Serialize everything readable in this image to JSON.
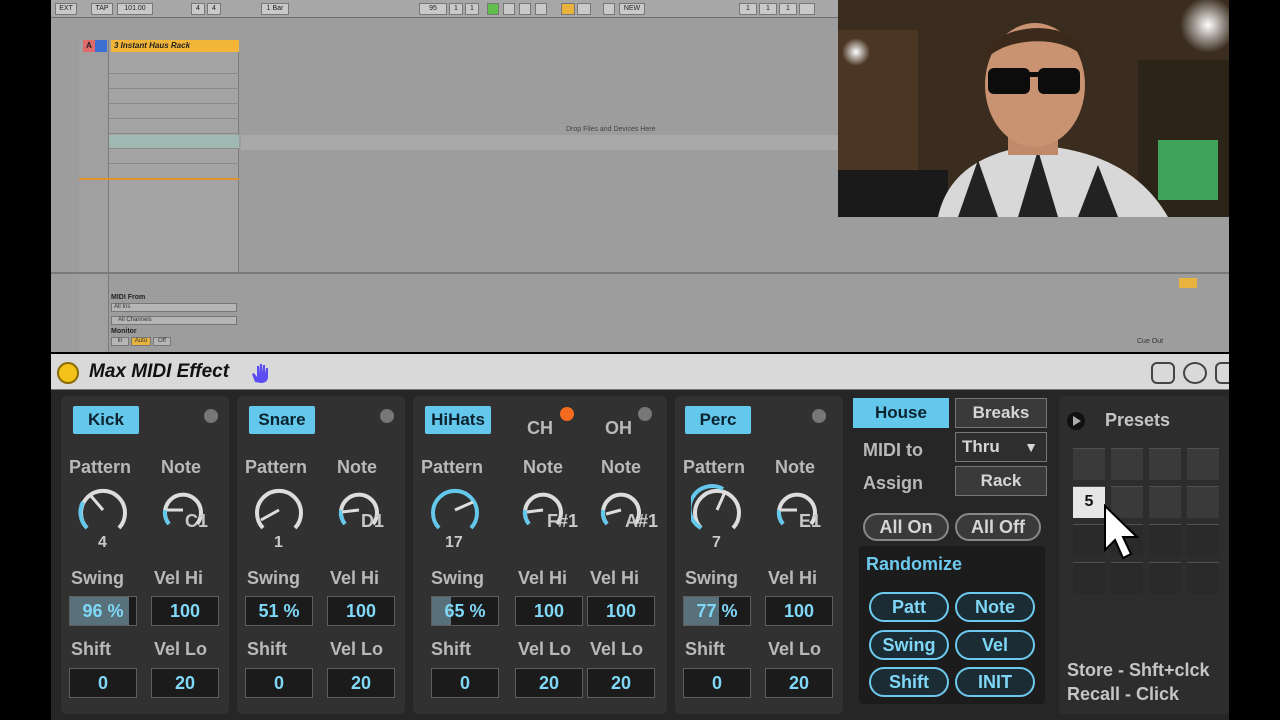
{
  "transport": {
    "ext": "EXT",
    "tap": "TAP",
    "tempo": "101.00",
    "sig_num": "4",
    "sig_den": "4",
    "quant": "1 Bar",
    "bars": "95",
    "beats": "1",
    "six": "1",
    "new": "NEW",
    "pos_a": "1",
    "pos_b": "1",
    "pos_c": "1"
  },
  "session": {
    "track_letter_a": "A",
    "track_name": "3 Instant Haus Rack",
    "drop_hint": "Drop Files and Devices Here",
    "midi_from": "MIDI From",
    "input_type": "All Ins",
    "input_channel": "All Channels",
    "monitor": "Monitor",
    "mon_in": "In",
    "mon_auto": "Auto",
    "mon_off": "Off",
    "cue_out": "Cue Out"
  },
  "device": {
    "title": "Max MIDI Effect",
    "channels": [
      {
        "name": "Kick",
        "pattern_label": "Pattern",
        "note_label": "Note",
        "pattern": "4",
        "note": "C1",
        "swing_label": "Swing",
        "swing": "96 %",
        "swing_pct": 96,
        "velhi_label": "Vel Hi",
        "velhi": "100",
        "shift_label": "Shift",
        "shift": "0",
        "vello_label": "Vel Lo",
        "vello": "20"
      },
      {
        "name": "Snare",
        "pattern_label": "Pattern",
        "note_label": "Note",
        "pattern": "1",
        "note": "D1",
        "swing_label": "Swing",
        "swing": "51 %",
        "swing_pct": 51,
        "velhi_label": "Vel Hi",
        "velhi": "100",
        "shift_label": "Shift",
        "shift": "0",
        "vello_label": "Vel Lo",
        "vello": "20"
      },
      {
        "name": "HiHats",
        "ch_label": "CH",
        "oh_label": "OH",
        "pattern_label": "Pattern",
        "note_label": "Note",
        "note2_label": "Note",
        "pattern": "17",
        "note": "F#1",
        "note2": "A#1",
        "swing_label": "Swing",
        "swing": "65 %",
        "swing_pct": 65,
        "velhi_label": "Vel Hi",
        "velhi": "100",
        "velhi2_label": "Vel Hi",
        "velhi2": "100",
        "shift_label": "Shift",
        "shift": "0",
        "vello_label": "Vel Lo",
        "vello": "20",
        "vello2_label": "Vel Lo",
        "vello2": "20"
      },
      {
        "name": "Perc",
        "pattern_label": "Pattern",
        "note_label": "Note",
        "pattern": "7",
        "note": "E1",
        "swing_label": "Swing",
        "swing": "77 %",
        "swing_pct": 77,
        "velhi_label": "Vel Hi",
        "velhi": "100",
        "shift_label": "Shift",
        "shift": "0",
        "vello_label": "Vel Lo",
        "vello": "20"
      }
    ],
    "style_house": "House",
    "style_breaks": "Breaks",
    "midi_to_label": "MIDI to",
    "midi_to_value": "Thru",
    "assign_label": "Assign",
    "assign_value": "Rack",
    "all_on": "All On",
    "all_off": "All Off",
    "randomize_label": "Randomize",
    "rand_patt": "Patt",
    "rand_note": "Note",
    "rand_swing": "Swing",
    "rand_vel": "Vel",
    "rand_shift": "Shift",
    "rand_init": "INIT",
    "presets_label": "Presets",
    "preset_selected": "5",
    "store_hint": "Store - Shft+clck",
    "recall_hint": "Recall - Click"
  },
  "colors": {
    "accent": "#64c8ec",
    "orange": "#f56a1e",
    "power": "#f2c21b"
  }
}
